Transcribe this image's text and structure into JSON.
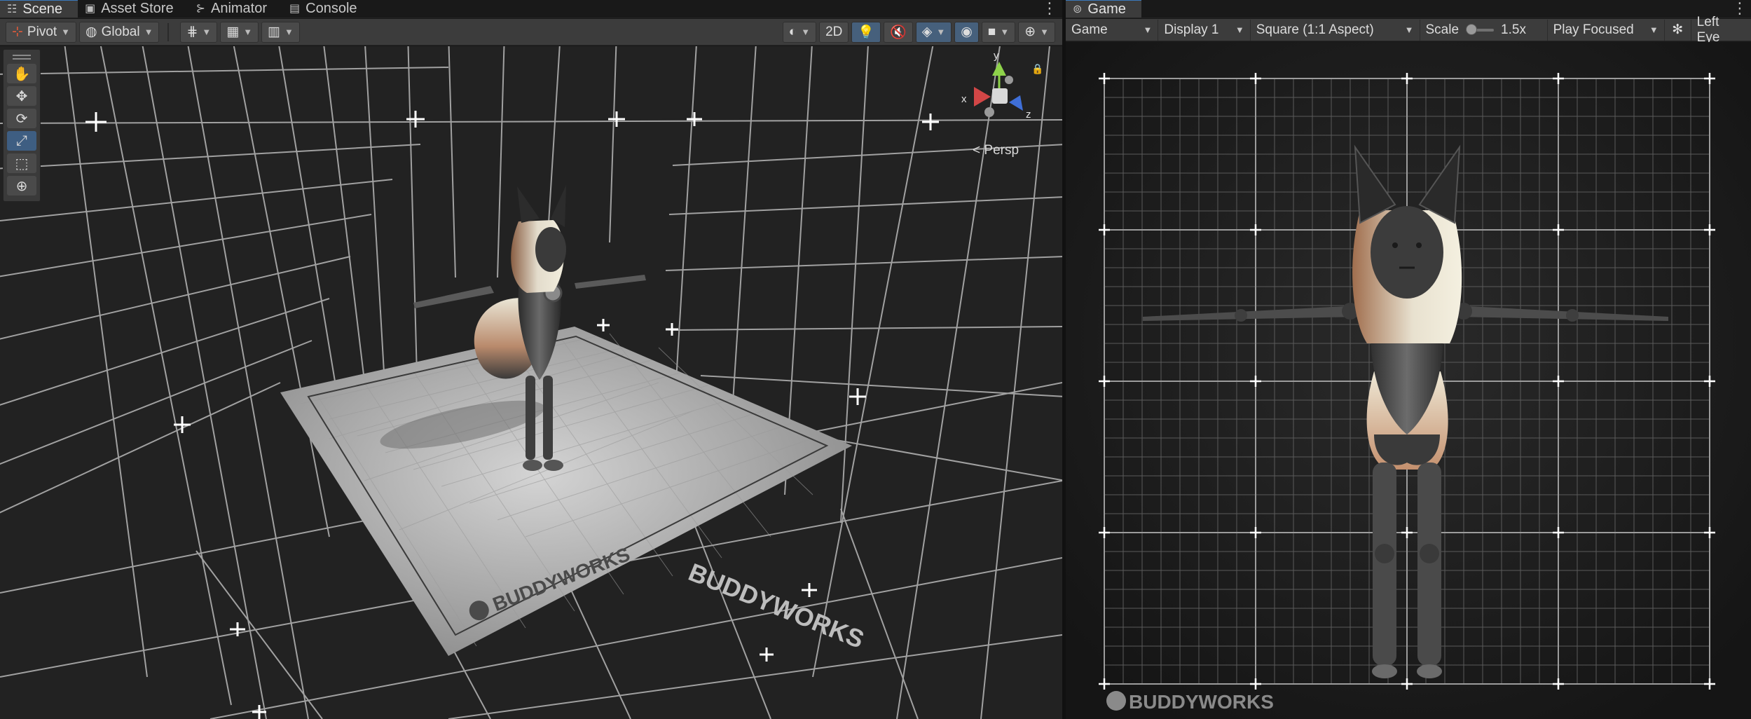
{
  "scene_tabs": [
    {
      "label": "Scene",
      "icon": "hash-icon",
      "active": true
    },
    {
      "label": "Asset Store",
      "icon": "bag-icon",
      "active": false
    },
    {
      "label": "Animator",
      "icon": "animator-icon",
      "active": false
    },
    {
      "label": "Console",
      "icon": "console-icon",
      "active": false
    }
  ],
  "game_tab": {
    "label": "Game",
    "icon": "gamepad-icon"
  },
  "scene_toolbar": {
    "pivot": "Pivot",
    "global": "Global",
    "mode_2d": "2D"
  },
  "game_toolbar": {
    "mode": "Game",
    "display": "Display 1",
    "aspect": "Square (1:1 Aspect)",
    "scale_label": "Scale",
    "scale_value": "1.5x",
    "play_mode": "Play Focused",
    "eye": "Left Eye"
  },
  "tools": [
    {
      "name": "hand-tool",
      "icon": "hand-icon",
      "glyph": "✋"
    },
    {
      "name": "move-tool",
      "icon": "move-icon",
      "glyph": "✥"
    },
    {
      "name": "rotate-tool",
      "icon": "rotate-icon",
      "glyph": "⟳"
    },
    {
      "name": "scale-tool",
      "icon": "scale-icon",
      "glyph": "⤢"
    },
    {
      "name": "rect-tool",
      "icon": "rect-icon",
      "glyph": "⬚"
    },
    {
      "name": "transform-tool",
      "icon": "transform-icon",
      "glyph": "⊕"
    }
  ],
  "scene": {
    "projection": "Persp",
    "gizmo_axes": {
      "x": "x",
      "y": "y",
      "z": "z"
    },
    "floor_brand": "BUDDYWORKS",
    "wall_brand": "BUDDYWORKS"
  },
  "game": {
    "brand": "BUDDYWORKS"
  },
  "colors": {
    "accent_blue": "#3a79bb",
    "gizmo_x": "#d24646",
    "gizmo_y": "#8ed24a",
    "gizmo_z": "#3f6fd8"
  }
}
